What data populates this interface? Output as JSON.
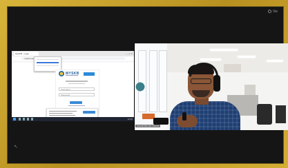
{
  "meeting": {
    "corner_label": "Vie",
    "presenter_name": "Ashraf Bin Ab Hamid"
  },
  "shared_screen": {
    "browser_tab": "MySKB - Login",
    "address": "myskb.usm.my",
    "portal_name": "MYSKB",
    "username_placeholder": "Username",
    "password_placeholder": "Password",
    "taskbar_time": "10:45"
  },
  "colors": {
    "frame_gold": "#c8a22a",
    "background": "#151515",
    "accent_blue": "#3b8ad8",
    "shirt_blue": "#1f3f73"
  }
}
